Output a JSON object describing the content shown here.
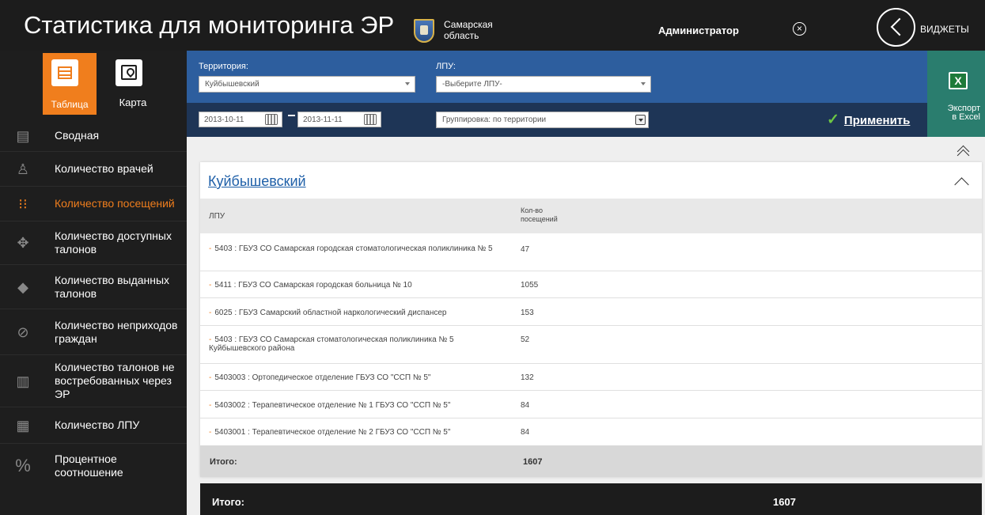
{
  "header": {
    "title": "Статистика для мониторинга ЭР",
    "region_line1": "Самарская",
    "region_line2": "область",
    "user": "Администратор",
    "widgets_label": "ВИДЖЕТЫ"
  },
  "sidebar": {
    "view_tabs": [
      {
        "label": "Таблица",
        "icon": "table-icon",
        "active": true
      },
      {
        "label": "Карта",
        "icon": "map-icon",
        "active": false
      }
    ],
    "items": [
      {
        "label": "Сводная",
        "icon": "summary-icon",
        "active": false
      },
      {
        "label": "Количество врачей",
        "icon": "doctor-icon",
        "active": false
      },
      {
        "label": "Количество посещений",
        "icon": "footprints-icon",
        "active": true
      },
      {
        "label": "Количество доступных талонов",
        "icon": "available-tickets-icon",
        "active": false
      },
      {
        "label": "Количество выданных талонов",
        "icon": "issued-tickets-icon",
        "active": false
      },
      {
        "label": "Количество неприходов граждан",
        "icon": "no-show-icon",
        "active": false
      },
      {
        "label": "Количество талонов не востребованных через ЭР",
        "icon": "unclaimed-chart-icon",
        "active": false
      },
      {
        "label": "Количество ЛПУ",
        "icon": "hospital-icon",
        "active": false
      },
      {
        "label": "Процентное соотношение",
        "icon": "percent-icon",
        "active": false
      }
    ]
  },
  "filters": {
    "territory_label": "Территория:",
    "territory_value": "Куйбышевский",
    "lpu_label": "ЛПУ:",
    "lpu_placeholder": "-Выберите ЛПУ-",
    "date_from": "2013-10-11",
    "date_to": "2013-11-11",
    "grouping": "Группировка: по территории",
    "apply_label": "Применить",
    "export_line1": "Экспорт",
    "export_line2": "в Excel"
  },
  "table": {
    "group_title": "Куйбышевский",
    "col_lpu": "ЛПУ",
    "col_visits_line1": "Кол-во",
    "col_visits_line2": "посещений",
    "rows": [
      {
        "toggle": "-",
        "name": "5403 : ГБУЗ СО Самарская городская стоматологическая поликлиника № 5",
        "value": "47"
      },
      {
        "toggle": "-",
        "name": "5411 : ГБУЗ СО Самарская городская больница № 10",
        "value": "1055"
      },
      {
        "toggle": "-",
        "name": "6025 : ГБУЗ Самарский областной наркологический диспансер",
        "value": "153"
      },
      {
        "toggle": "-",
        "name": "5403 : ГБУЗ СО Самарская стоматологическая поликлиника № 5 Куйбышевского района",
        "value": "52"
      },
      {
        "toggle": "-",
        "name": "5403003 : Ортопедическое отделение ГБУЗ СО \"ССП № 5\"",
        "value": "132"
      },
      {
        "toggle": "-",
        "name": "5403002 : Терапевтическое отделение № 1 ГБУЗ СО \"ССП № 5\"",
        "value": "84"
      },
      {
        "toggle": "-",
        "name": "5403001 : Терапевтическое отделение № 2 ГБУЗ СО \"ССП № 5\"",
        "value": "84"
      }
    ],
    "subtotal_label": "Итого:",
    "subtotal_value": "1607"
  },
  "grand_total": {
    "label": "Итого:",
    "value": "1607"
  },
  "colors": {
    "accent": "#f07e1d",
    "filter_blue": "#2d5e9e",
    "filter_dark": "#1e3556",
    "excel_green": "#2a7d6e",
    "link": "#1e5fa8"
  }
}
